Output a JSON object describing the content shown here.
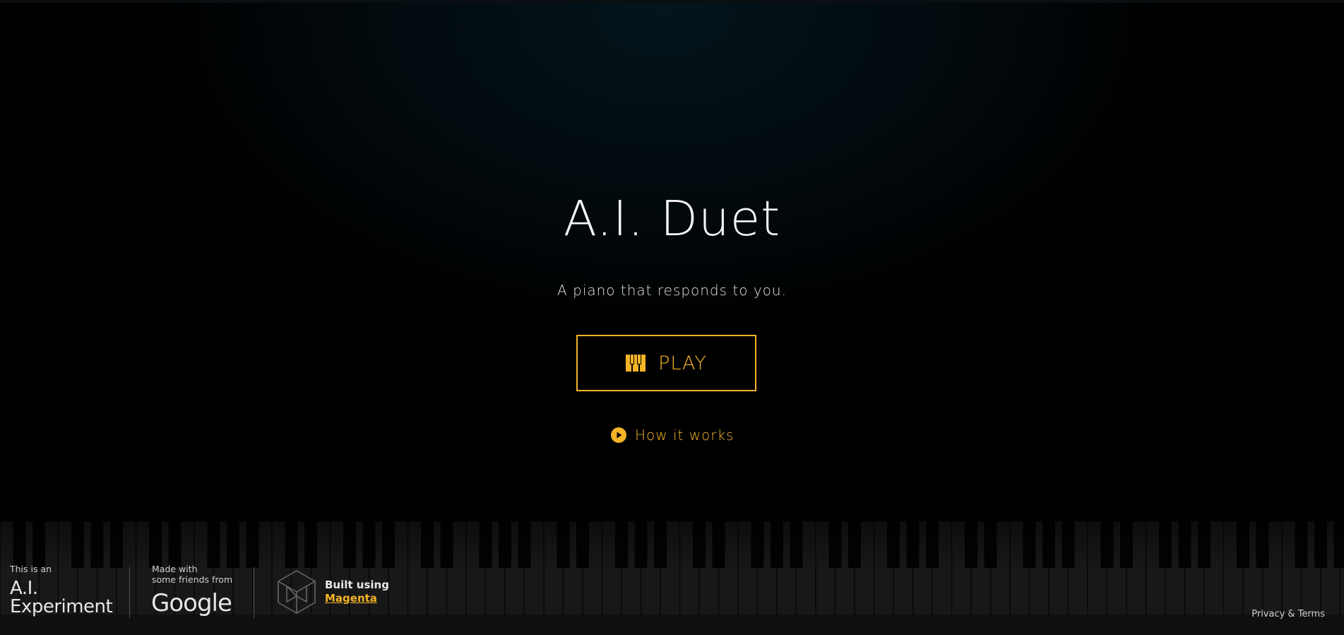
{
  "hero": {
    "title": "A.I. Duet",
    "subtitle": "A piano that responds to you.",
    "play_label": "PLAY",
    "how_label": "How it works"
  },
  "footer": {
    "experiment_prefix": "This is an",
    "experiment_line1": "A.I.",
    "experiment_line2": "Experiment",
    "made_with_line1": "Made with",
    "made_with_line2": "some friends from",
    "google_wordmark": "Google",
    "built_using": "Built using",
    "magenta_link": "Magenta",
    "privacy_terms": "Privacy & Terms"
  },
  "colors": {
    "accent": "#f4b428",
    "background": "#000000",
    "text": "#f4f4f4"
  },
  "icons": {
    "play_button_icon": "piano-keys-icon",
    "how_it_works_icon": "play-circle-icon",
    "magenta_logo": "magenta-cube-logo"
  }
}
